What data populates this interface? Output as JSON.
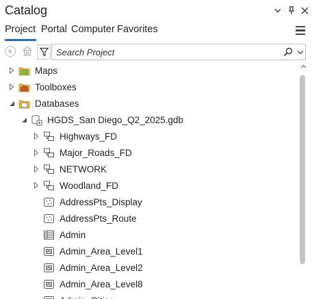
{
  "pane": {
    "title": "Catalog",
    "controls": {
      "options": "⌄",
      "pin": "⊥",
      "close": "✕"
    }
  },
  "tabs": [
    {
      "label": "Project",
      "active": true
    },
    {
      "label": "Portal",
      "active": false
    },
    {
      "label": "Computer",
      "active": false
    },
    {
      "label": "Favorites",
      "active": false
    }
  ],
  "search": {
    "placeholder": "Search Project",
    "value": ""
  },
  "tree": [
    {
      "label": "Maps",
      "level": 0,
      "expanded": false,
      "icon": "maps-folder-icon"
    },
    {
      "label": "Toolboxes",
      "level": 0,
      "expanded": false,
      "icon": "toolboxes-folder-icon"
    },
    {
      "label": "Databases",
      "level": 0,
      "expanded": true,
      "icon": "databases-folder-icon"
    },
    {
      "label": "HGDS_San Diego_Q2_2025.gdb",
      "level": 1,
      "expanded": true,
      "icon": "geodatabase-icon"
    },
    {
      "label": "Highways_FD",
      "level": 2,
      "expanded": false,
      "icon": "feature-dataset-icon"
    },
    {
      "label": "Major_Roads_FD",
      "level": 2,
      "expanded": false,
      "icon": "feature-dataset-icon"
    },
    {
      "label": "NETWORK",
      "level": 2,
      "expanded": false,
      "icon": "feature-dataset-icon"
    },
    {
      "label": "Woodland_FD",
      "level": 2,
      "expanded": false,
      "icon": "feature-dataset-icon"
    },
    {
      "label": "AddressPts_Display",
      "level": 2,
      "icon": "point-feature-class-icon"
    },
    {
      "label": "AddressPts_Route",
      "level": 2,
      "icon": "point-feature-class-icon"
    },
    {
      "label": "Admin",
      "level": 2,
      "icon": "table-icon"
    },
    {
      "label": "Admin_Area_Level1",
      "level": 2,
      "icon": "polygon-feature-class-icon"
    },
    {
      "label": "Admin_Area_Level2",
      "level": 2,
      "icon": "polygon-feature-class-icon"
    },
    {
      "label": "Admin_Area_Level8",
      "level": 2,
      "icon": "polygon-feature-class-icon"
    },
    {
      "label": "Admin_Cities",
      "level": 2,
      "icon": "polygon-feature-class-icon"
    }
  ],
  "colors": {
    "accent": "#1e6fc8",
    "folder": "#e8b23a",
    "toolbox": "#d0532a",
    "scroll_thumb": "#c3c3c3"
  }
}
